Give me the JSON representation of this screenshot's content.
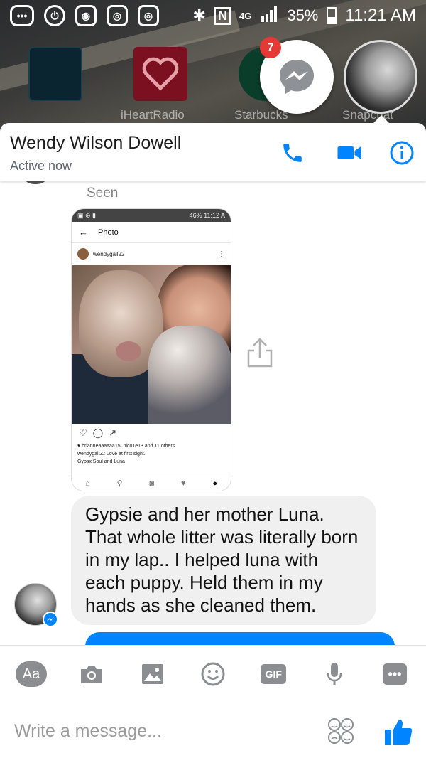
{
  "status_bar": {
    "network": "4G",
    "battery": "35%",
    "time": "11:21 AM"
  },
  "home": {
    "app_labels": [
      "iHeartRadio",
      "Starbucks",
      "Snapchat"
    ],
    "chathead_badge": "7"
  },
  "header": {
    "contact_name": "Wendy Wilson Dowell",
    "status": "Active now"
  },
  "thread": {
    "seen_label": "Seen",
    "shared_screenshot": {
      "status_left": "46%",
      "status_time": "11:12 A",
      "appbar_title": "Photo",
      "username": "wendygail22",
      "likes_line": "brianneaaaaaa15, nico1e13 and 11 others",
      "caption_line1": "wendygail22 Love at first sight.",
      "caption_line2": "GypsieSoul and Luna"
    },
    "message_text": "Gypsie and her mother Luna. That whole litter was literally born in my lap.. I helped luna with each  puppy. Held them in my hands as she cleaned them."
  },
  "composer": {
    "text_tool_label": "Aa",
    "gif_label": "GIF",
    "placeholder": "Write a message...",
    "colors": {
      "accent": "#0084ff",
      "tool_gray": "#8b8d90"
    }
  }
}
